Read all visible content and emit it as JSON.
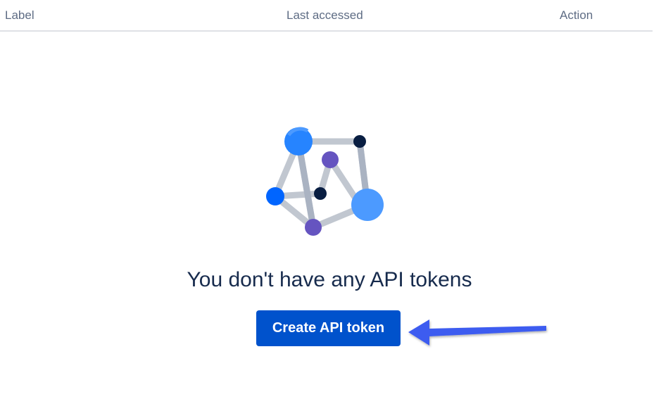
{
  "table": {
    "columns": [
      "Label",
      "Last accessed",
      "Action"
    ]
  },
  "empty_state": {
    "title": "You don't have any API tokens",
    "illustration": "network-graph-illustration"
  },
  "actions": {
    "create_label": "Create API token"
  },
  "annotation": {
    "icon": "arrow-pointer-icon"
  },
  "colors": {
    "primary": "#0052cc",
    "arrow": "#3e5cf0",
    "header_text": "#5e6c84",
    "title_text": "#172b4d",
    "divider": "#dfe1e6"
  }
}
